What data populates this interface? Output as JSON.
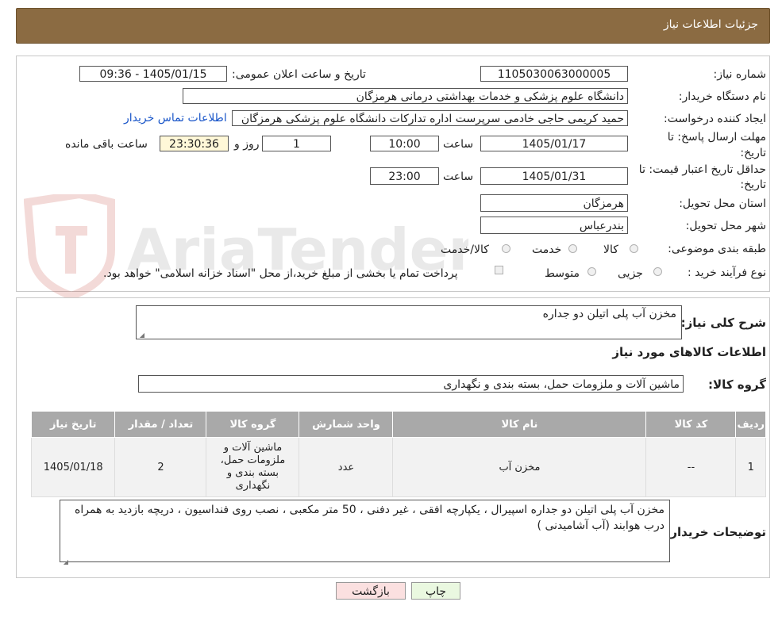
{
  "header": {
    "title": "جزئیات اطلاعات نیاز"
  },
  "form": {
    "need_number_label": "شماره نیاز:",
    "need_number": "1105030063000005",
    "announce_label": "تاریخ و ساعت اعلان عمومی:",
    "announce_value": "1405/01/15 - 09:36",
    "buyer_org_label": "نام دستگاه خریدار:",
    "buyer_org": "دانشگاه علوم پزشکی و خدمات بهداشتی درمانی هرمزگان",
    "creator_label": "ایجاد کننده درخواست:",
    "creator": "حمید کریمی حاجی خادمی سرپرست اداره تدارکات دانشگاه علوم پزشکی هرمزگان",
    "contact_link": "اطلاعات تماس خریدار",
    "deadline_label_1": "مهلت ارسال پاسخ: تا",
    "deadline_label_2": "تاریخ:",
    "deadline_date": "1405/01/17",
    "time_label": "ساعت",
    "deadline_time": "10:00",
    "days_value": "1",
    "days_label": "روز و",
    "remaining_time": "23:30:36",
    "remaining_label": "ساعت باقی مانده",
    "validity_label_1": "حداقل تاریخ اعتبار قیمت: تا",
    "validity_label_2": "تاریخ:",
    "validity_date": "1405/01/31",
    "validity_time": "23:00",
    "province_label": "استان محل تحویل:",
    "province": "هرمزگان",
    "city_label": "شهر محل تحویل:",
    "city": "بندرعباس",
    "category_label": "طبقه بندی موضوعی:",
    "category_options": [
      "کالا",
      "خدمت",
      "کالا/خدمت"
    ],
    "purchase_type_label": "نوع فرآیند خرید :",
    "purchase_options": [
      "جزیی",
      "متوسط"
    ],
    "payment_note": "پرداخت تمام یا بخشی از مبلغ خرید،از محل \"اسناد خزانه اسلامی\" خواهد بود."
  },
  "watermark": {
    "text": "AriaTender.neT"
  },
  "details": {
    "summary_label": "شرح کلی نیاز:",
    "summary_value": "مخزن آب پلی اتیلن دو جداره",
    "items_title": "اطلاعات کالاهای مورد نیاز",
    "group_label": "گروه کالا:",
    "group_value": "ماشین آلات و ملزومات حمل، بسته بندی و نگهداری",
    "table": {
      "headers": [
        "ردیف",
        "کد کالا",
        "نام کالا",
        "واحد شمارش",
        "گروه کالا",
        "تعداد / مقدار",
        "تاریخ نیاز"
      ],
      "rows": [
        [
          "1",
          "--",
          "مخزن آب",
          "عدد",
          "ماشین آلات و ملزومات حمل، بسته بندی و نگهداری",
          "2",
          "1405/01/18"
        ]
      ]
    },
    "buyer_notes_label": "توضیحات خریدار:",
    "buyer_notes": "مخزن آب پلی اتیلن دو جداره اسپیرال ، یکپارچه افقی ، غیر دفنی ، 50 متر مکعبی ، نصب روی فنداسیون ، دریچه بازدید به همراه درب هوابند (آب آشامیدنی )"
  },
  "buttons": {
    "print": "چاپ",
    "back": "بازگشت"
  },
  "colors": {
    "header_bg": "#8b6b42",
    "table_header": "#a9a9a9",
    "link": "#1a56c9",
    "back_button": "#fbe0e0",
    "print_button": "#eaf8e0"
  }
}
